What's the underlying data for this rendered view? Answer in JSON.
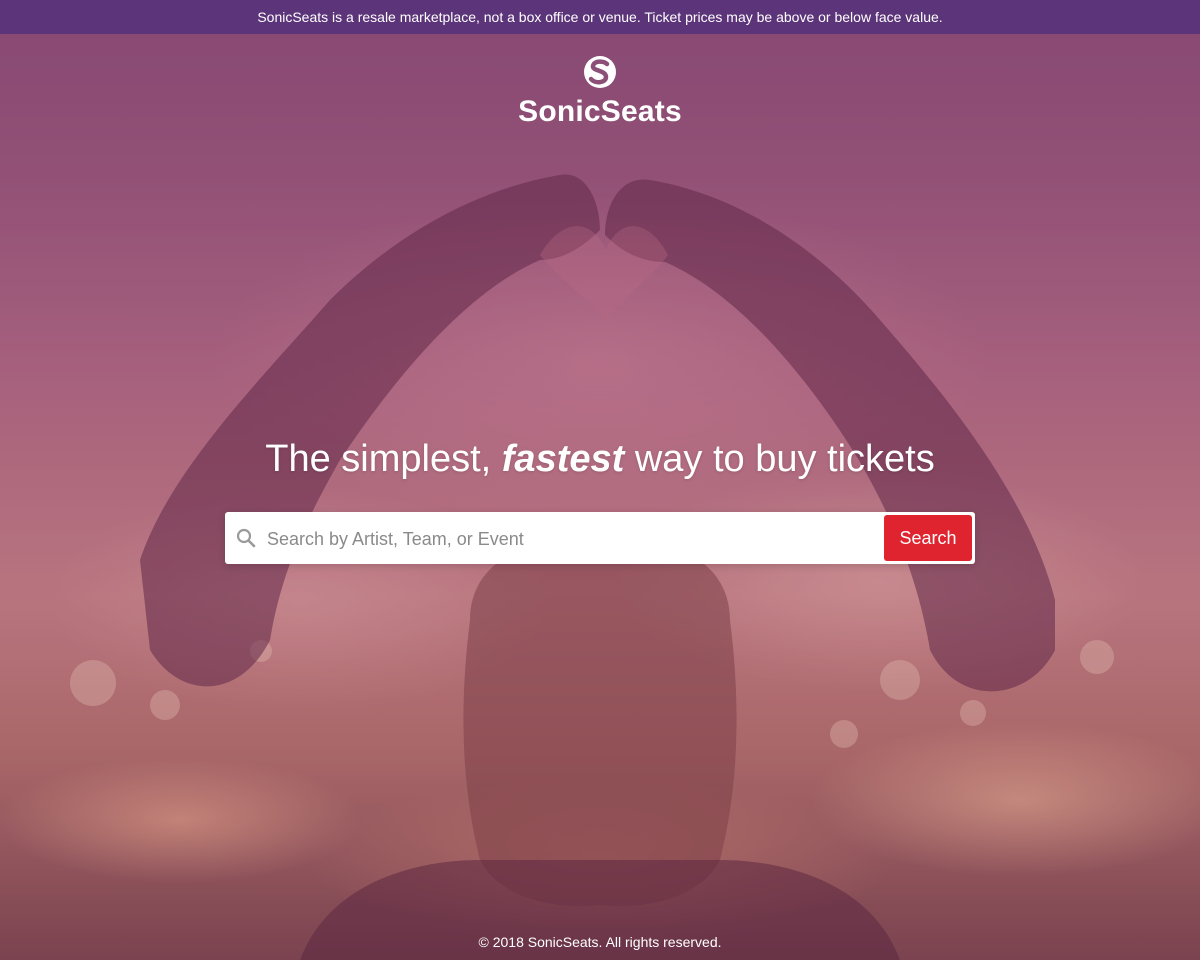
{
  "notice": {
    "text": "SonicSeats is a resale marketplace, not a box office or venue. Ticket prices may be above or below face value."
  },
  "brand": {
    "name": "SonicSeats",
    "logo_icon": "sonicseats-s-logo"
  },
  "hero": {
    "heading_before": "The simplest, ",
    "heading_emphasis": "fastest",
    "heading_after": " way to buy tickets"
  },
  "search": {
    "icon": "search-icon",
    "placeholder": "Search by Artist, Team, or Event",
    "value": "",
    "button_label": "Search"
  },
  "footer": {
    "copyright": "©  2018 SonicSeats. All rights reserved."
  },
  "colors": {
    "notice_bar": "#5c3479",
    "search_button": "#e0242f",
    "text": "#ffffff"
  }
}
